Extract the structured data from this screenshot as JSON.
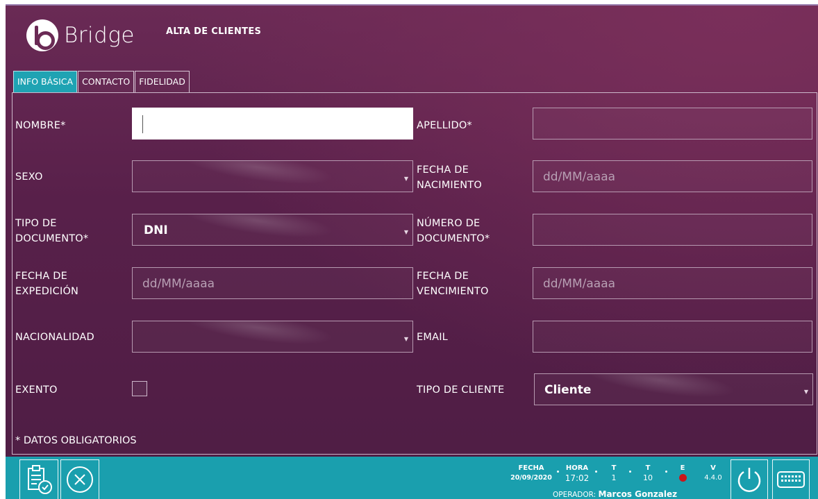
{
  "app": {
    "brand": "Bridge",
    "title": "ALTA DE CLIENTES"
  },
  "tabs": [
    {
      "label": "INFO BÁSICA",
      "active": true
    },
    {
      "label": "CONTACTO",
      "active": false
    },
    {
      "label": "FIDELIDAD",
      "active": false
    }
  ],
  "form": {
    "nombre": {
      "label": "NOMBRE*",
      "value": ""
    },
    "apellido": {
      "label": "APELLIDO*",
      "value": ""
    },
    "sexo": {
      "label": "SEXO",
      "value": ""
    },
    "fecha_nacimiento": {
      "label_line1": "FECHA DE",
      "label_line2": "NACIMIENTO",
      "placeholder": "dd/MM/aaaa"
    },
    "tipo_documento": {
      "label_line1": "TIPO DE",
      "label_line2": "DOCUMENTO*",
      "value": "DNI"
    },
    "numero_documento": {
      "label_line1": "NÚMERO DE",
      "label_line2": "DOCUMENTO*",
      "value": ""
    },
    "fecha_expedicion": {
      "label_line1": "FECHA DE",
      "label_line2": "EXPEDICIÓN",
      "placeholder": "dd/MM/aaaa"
    },
    "fecha_vencimiento": {
      "label_line1": "FECHA DE",
      "label_line2": "VENCIMIENTO",
      "placeholder": "dd/MM/aaaa"
    },
    "nacionalidad": {
      "label": "NACIONALIDAD",
      "value": ""
    },
    "email": {
      "label": "EMAIL",
      "value": ""
    },
    "exento": {
      "label": "EXENTO",
      "checked": false
    },
    "tipo_cliente": {
      "label": "TIPO DE CLIENTE",
      "value": "Cliente"
    }
  },
  "required_note": "* DATOS OBLIGATORIOS",
  "footer": {
    "fecha": {
      "label": "FECHA",
      "value": "20/09/2020"
    },
    "hora": {
      "label": "HORA",
      "value": "17:02"
    },
    "t1": {
      "label": "T",
      "value": "1"
    },
    "t2": {
      "label": "T",
      "value": "10"
    },
    "e": {
      "label": "E",
      "status_color": "#c9161b"
    },
    "v": {
      "label": "V",
      "value": "4.4.0"
    },
    "operator_label": "OPERADOR:",
    "operator_name": "Marcos Gonzalez"
  },
  "icons": {
    "save": "clipboard-check-icon",
    "cancel": "close-circle-icon",
    "power": "power-icon",
    "keyboard": "keyboard-icon"
  },
  "colors": {
    "background": "#5a2150",
    "accent": "#1fa3b3",
    "footer": "#1a9fae"
  }
}
